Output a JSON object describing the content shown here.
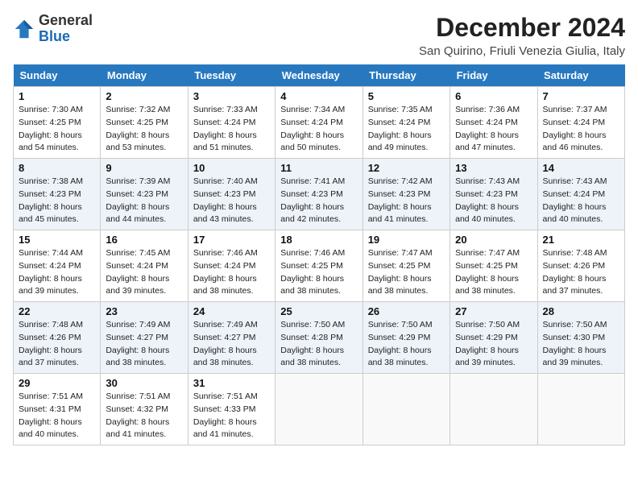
{
  "header": {
    "logo_general": "General",
    "logo_blue": "Blue",
    "month_year": "December 2024",
    "location": "San Quirino, Friuli Venezia Giulia, Italy"
  },
  "calendar": {
    "days_of_week": [
      "Sunday",
      "Monday",
      "Tuesday",
      "Wednesday",
      "Thursday",
      "Friday",
      "Saturday"
    ],
    "weeks": [
      [
        null,
        {
          "day": "2",
          "sunrise": "Sunrise: 7:32 AM",
          "sunset": "Sunset: 4:25 PM",
          "daylight": "Daylight: 8 hours and 53 minutes."
        },
        {
          "day": "3",
          "sunrise": "Sunrise: 7:33 AM",
          "sunset": "Sunset: 4:24 PM",
          "daylight": "Daylight: 8 hours and 51 minutes."
        },
        {
          "day": "4",
          "sunrise": "Sunrise: 7:34 AM",
          "sunset": "Sunset: 4:24 PM",
          "daylight": "Daylight: 8 hours and 50 minutes."
        },
        {
          "day": "5",
          "sunrise": "Sunrise: 7:35 AM",
          "sunset": "Sunset: 4:24 PM",
          "daylight": "Daylight: 8 hours and 49 minutes."
        },
        {
          "day": "6",
          "sunrise": "Sunrise: 7:36 AM",
          "sunset": "Sunset: 4:24 PM",
          "daylight": "Daylight: 8 hours and 47 minutes."
        },
        {
          "day": "7",
          "sunrise": "Sunrise: 7:37 AM",
          "sunset": "Sunset: 4:24 PM",
          "daylight": "Daylight: 8 hours and 46 minutes."
        }
      ],
      [
        {
          "day": "1",
          "sunrise": "Sunrise: 7:30 AM",
          "sunset": "Sunset: 4:25 PM",
          "daylight": "Daylight: 8 hours and 54 minutes."
        },
        {
          "day": "8",
          "sunrise": "Sunrise: 7:38 AM",
          "sunset": "Sunset: 4:23 PM",
          "daylight": "Daylight: 8 hours and 45 minutes."
        },
        {
          "day": "9",
          "sunrise": "Sunrise: 7:39 AM",
          "sunset": "Sunset: 4:23 PM",
          "daylight": "Daylight: 8 hours and 44 minutes."
        },
        {
          "day": "10",
          "sunrise": "Sunrise: 7:40 AM",
          "sunset": "Sunset: 4:23 PM",
          "daylight": "Daylight: 8 hours and 43 minutes."
        },
        {
          "day": "11",
          "sunrise": "Sunrise: 7:41 AM",
          "sunset": "Sunset: 4:23 PM",
          "daylight": "Daylight: 8 hours and 42 minutes."
        },
        {
          "day": "12",
          "sunrise": "Sunrise: 7:42 AM",
          "sunset": "Sunset: 4:23 PM",
          "daylight": "Daylight: 8 hours and 41 minutes."
        },
        {
          "day": "13",
          "sunrise": "Sunrise: 7:43 AM",
          "sunset": "Sunset: 4:23 PM",
          "daylight": "Daylight: 8 hours and 40 minutes."
        },
        {
          "day": "14",
          "sunrise": "Sunrise: 7:43 AM",
          "sunset": "Sunset: 4:24 PM",
          "daylight": "Daylight: 8 hours and 40 minutes."
        }
      ],
      [
        {
          "day": "15",
          "sunrise": "Sunrise: 7:44 AM",
          "sunset": "Sunset: 4:24 PM",
          "daylight": "Daylight: 8 hours and 39 minutes."
        },
        {
          "day": "16",
          "sunrise": "Sunrise: 7:45 AM",
          "sunset": "Sunset: 4:24 PM",
          "daylight": "Daylight: 8 hours and 39 minutes."
        },
        {
          "day": "17",
          "sunrise": "Sunrise: 7:46 AM",
          "sunset": "Sunset: 4:24 PM",
          "daylight": "Daylight: 8 hours and 38 minutes."
        },
        {
          "day": "18",
          "sunrise": "Sunrise: 7:46 AM",
          "sunset": "Sunset: 4:25 PM",
          "daylight": "Daylight: 8 hours and 38 minutes."
        },
        {
          "day": "19",
          "sunrise": "Sunrise: 7:47 AM",
          "sunset": "Sunset: 4:25 PM",
          "daylight": "Daylight: 8 hours and 38 minutes."
        },
        {
          "day": "20",
          "sunrise": "Sunrise: 7:47 AM",
          "sunset": "Sunset: 4:25 PM",
          "daylight": "Daylight: 8 hours and 38 minutes."
        },
        {
          "day": "21",
          "sunrise": "Sunrise: 7:48 AM",
          "sunset": "Sunset: 4:26 PM",
          "daylight": "Daylight: 8 hours and 37 minutes."
        }
      ],
      [
        {
          "day": "22",
          "sunrise": "Sunrise: 7:48 AM",
          "sunset": "Sunset: 4:26 PM",
          "daylight": "Daylight: 8 hours and 37 minutes."
        },
        {
          "day": "23",
          "sunrise": "Sunrise: 7:49 AM",
          "sunset": "Sunset: 4:27 PM",
          "daylight": "Daylight: 8 hours and 38 minutes."
        },
        {
          "day": "24",
          "sunrise": "Sunrise: 7:49 AM",
          "sunset": "Sunset: 4:27 PM",
          "daylight": "Daylight: 8 hours and 38 minutes."
        },
        {
          "day": "25",
          "sunrise": "Sunrise: 7:50 AM",
          "sunset": "Sunset: 4:28 PM",
          "daylight": "Daylight: 8 hours and 38 minutes."
        },
        {
          "day": "26",
          "sunrise": "Sunrise: 7:50 AM",
          "sunset": "Sunset: 4:29 PM",
          "daylight": "Daylight: 8 hours and 38 minutes."
        },
        {
          "day": "27",
          "sunrise": "Sunrise: 7:50 AM",
          "sunset": "Sunset: 4:29 PM",
          "daylight": "Daylight: 8 hours and 39 minutes."
        },
        {
          "day": "28",
          "sunrise": "Sunrise: 7:50 AM",
          "sunset": "Sunset: 4:30 PM",
          "daylight": "Daylight: 8 hours and 39 minutes."
        }
      ],
      [
        {
          "day": "29",
          "sunrise": "Sunrise: 7:51 AM",
          "sunset": "Sunset: 4:31 PM",
          "daylight": "Daylight: 8 hours and 40 minutes."
        },
        {
          "day": "30",
          "sunrise": "Sunrise: 7:51 AM",
          "sunset": "Sunset: 4:32 PM",
          "daylight": "Daylight: 8 hours and 41 minutes."
        },
        {
          "day": "31",
          "sunrise": "Sunrise: 7:51 AM",
          "sunset": "Sunset: 4:33 PM",
          "daylight": "Daylight: 8 hours and 41 minutes."
        },
        null,
        null,
        null,
        null
      ]
    ]
  }
}
